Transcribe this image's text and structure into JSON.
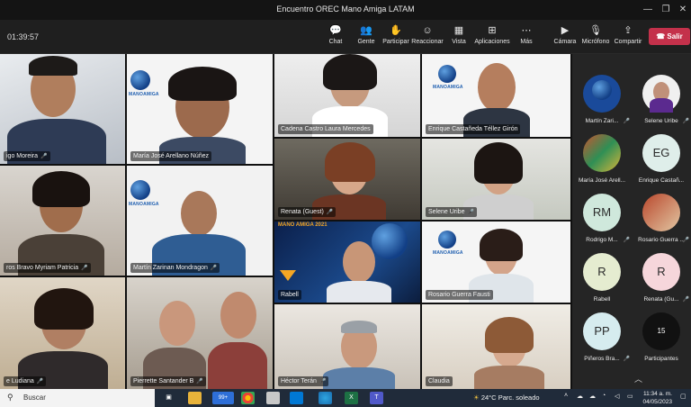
{
  "window": {
    "title": "Encuentro OREC Mano Amiga LATAM",
    "minimize": "—",
    "maximize": "❐",
    "close": "✕"
  },
  "toolbar": {
    "timer": "01:39:57",
    "chat": "Chat",
    "people": "Gente",
    "raise": "Participar",
    "react": "Reaccionar",
    "view": "Vista",
    "apps": "Aplicaciones",
    "more": "Más",
    "camera": "Cámara",
    "mic": "Micrófono",
    "share": "Compartir",
    "leave": "Salir"
  },
  "icons": {
    "chat": "💬",
    "people": "👥",
    "raise": "✋",
    "react": "☺",
    "view": "▦",
    "apps": "⊞",
    "more": "⋯",
    "camera": "▶",
    "mic": "🎙",
    "share": "⇪",
    "leave": "☎",
    "mic_small": "🎤",
    "chevron": "︿",
    "search": "⚲",
    "windows": "⊞"
  },
  "tiles": [
    {
      "name": "igo Moreira"
    },
    {
      "name": "María José Arellano Núñez",
      "brand": "MANOAMIGA"
    },
    {
      "name": "Cadena Castro Laura Mercedes"
    },
    {
      "name": "Enrique Castañeda Téllez Girón",
      "brand": "MANOAMIGA"
    },
    {
      "name": "ros Bravo Myriam Patricia"
    },
    {
      "name": "Martín Zarinan Mondragon",
      "brand": "MANOAMIGA"
    },
    {
      "name": "Renata (Guest)"
    },
    {
      "name": "Selene Uribe"
    },
    {
      "name": "Rabell",
      "banner": "MANO AMIGA 2021"
    },
    {
      "name": "Rosario Guerra Fausti",
      "brand": "MANOAMIGA"
    },
    {
      "name": "e Ludiana"
    },
    {
      "name": "Pierrette Santander B"
    },
    {
      "name": "Héctor Terán"
    },
    {
      "name": "Claudia"
    }
  ],
  "roster": [
    {
      "name": "Martín Zari...",
      "initials": "",
      "color": "#1a4a9a"
    },
    {
      "name": "Selene Uribe",
      "initials": "",
      "color": "#f0f0f0"
    },
    {
      "name": "María José Arell...",
      "initials": "",
      "color": "#c9542f"
    },
    {
      "name": "Enrique Castañ...",
      "initials": "EG",
      "color": "#dfeeea"
    },
    {
      "name": "Rodrigo M...",
      "initials": "RM",
      "color": "#cfe8dc"
    },
    {
      "name": "Rosario Guerra ...",
      "initials": "",
      "color": "#b9472c"
    },
    {
      "name": "Rabell",
      "initials": "R",
      "color": "#e5ecd0"
    },
    {
      "name": "Renata (Gu...",
      "initials": "R",
      "color": "#f6d6db"
    },
    {
      "name": "Piñeros Bra...",
      "initials": "PP",
      "color": "#d6ecef"
    },
    {
      "name": "Participantes",
      "initials": "15",
      "color": "#111111"
    }
  ],
  "taskbar": {
    "search_label": "Buscar",
    "badge": "99+",
    "weather_temp": "24°C",
    "weather_desc": "Parc. soleado",
    "time": "11:34 a. m.",
    "date": "04/05/2023"
  },
  "colors": {
    "leave": "#c4314b",
    "taskbar": "#202b3a",
    "teams": "#5059c9"
  }
}
